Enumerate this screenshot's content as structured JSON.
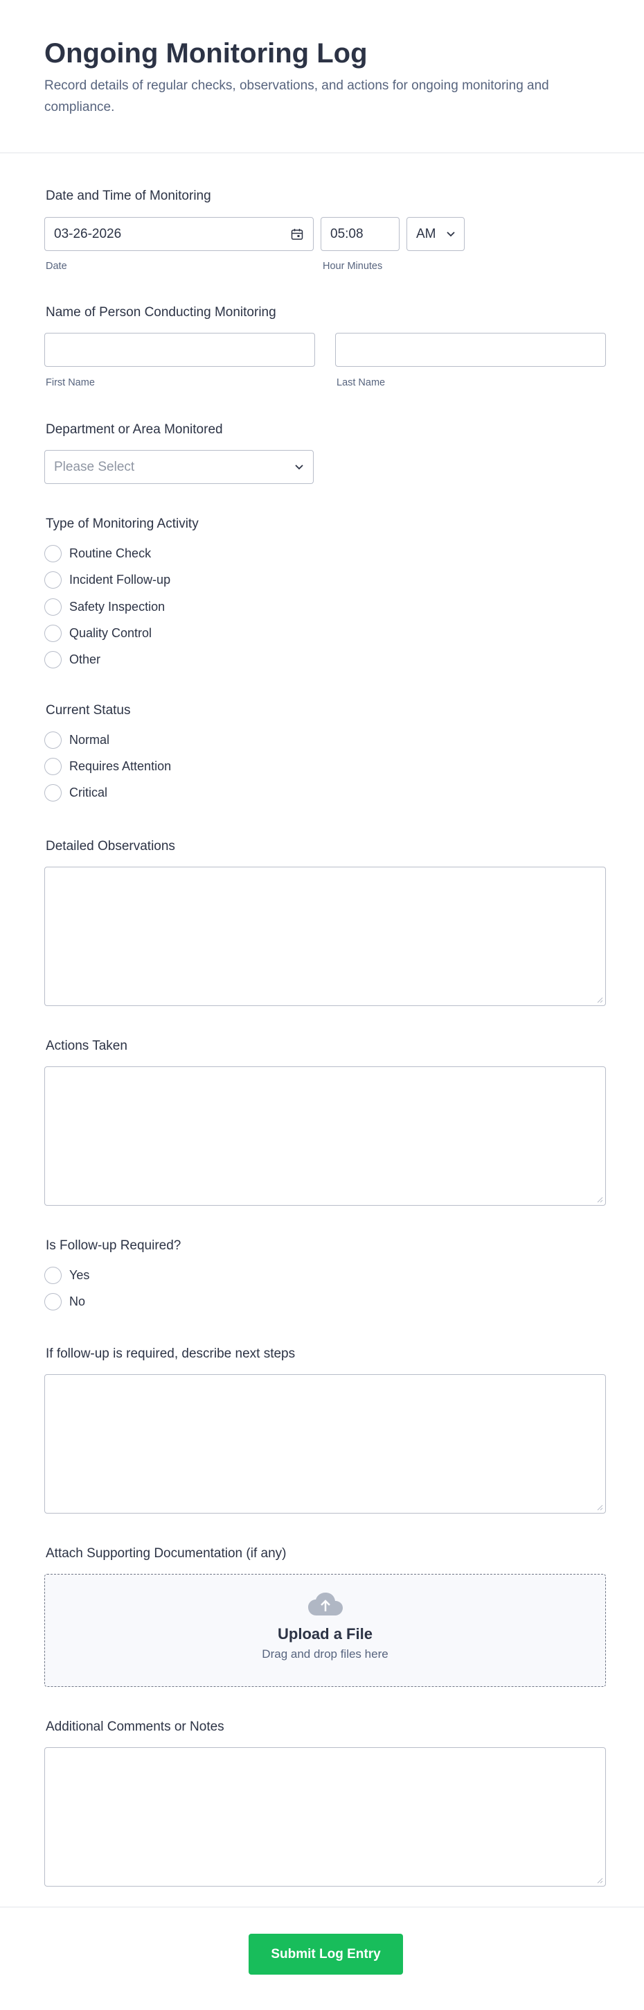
{
  "header": {
    "title": "Ongoing Monitoring Log",
    "subtitle": "Record details of regular checks, observations, and actions for ongoing monitoring and compliance."
  },
  "datetime": {
    "label": "Date and Time of Monitoring",
    "date_value": "03-26-2026",
    "date_sublabel": "Date",
    "time_value": "05:08",
    "ampm_value": "AM",
    "time_sublabel": "Hour Minutes",
    "calendar_icon": "calendar-icon"
  },
  "person": {
    "label": "Name of Person Conducting Monitoring",
    "first_sublabel": "First Name",
    "last_sublabel": "Last Name"
  },
  "department": {
    "label": "Department or Area Monitored",
    "placeholder": "Please Select"
  },
  "activity": {
    "label": "Type of Monitoring Activity",
    "options": [
      "Routine Check",
      "Incident Follow-up",
      "Safety Inspection",
      "Quality Control",
      "Other"
    ]
  },
  "status": {
    "label": "Current Status",
    "options": [
      "Normal",
      "Requires Attention",
      "Critical"
    ]
  },
  "observations": {
    "label": "Detailed Observations"
  },
  "actions": {
    "label": "Actions Taken"
  },
  "followup": {
    "label": "Is Follow-up Required?",
    "options": [
      "Yes",
      "No"
    ]
  },
  "next_steps": {
    "label": "If follow-up is required, describe next steps"
  },
  "attachment": {
    "label": "Attach Supporting Documentation (if any)",
    "title": "Upload a File",
    "subtitle": "Drag and drop files here",
    "icon": "cloud-upload-icon"
  },
  "comments": {
    "label": "Additional Comments or Notes"
  },
  "submit": {
    "label": "Submit Log Entry"
  },
  "colors": {
    "submit_bg": "#18bd5b",
    "text": "#2c3345",
    "muted": "#57647e",
    "border": "#b8bdc9"
  }
}
